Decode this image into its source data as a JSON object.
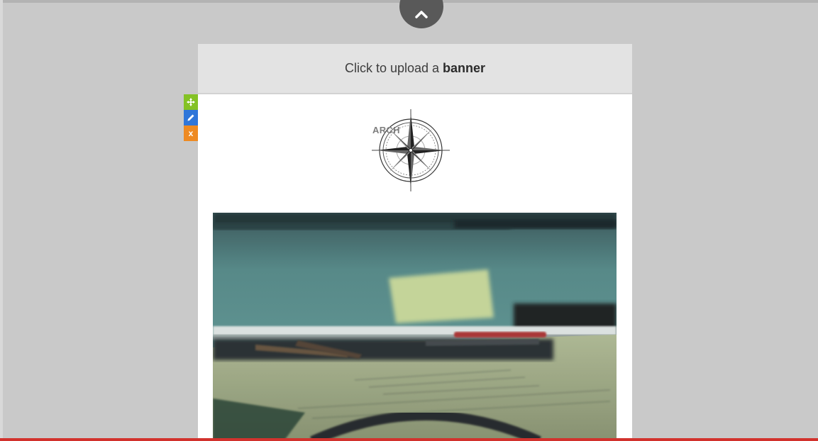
{
  "banner": {
    "prefix": "Click to upload a",
    "emphasis": "banner"
  },
  "logo": {
    "text": "ARCH"
  },
  "block_tools": {
    "move_icon": "move-icon",
    "edit_icon": "pencil-icon",
    "delete_label": "x"
  },
  "collapse": {
    "icon": "chevron-up-icon"
  },
  "colors": {
    "canvas_bg": "#c9c9c9",
    "banner_bg": "#e3e3e3",
    "move": "#84c225",
    "edit": "#2f76d9",
    "delete": "#ee8a22",
    "accent_line": "#d2322d"
  }
}
